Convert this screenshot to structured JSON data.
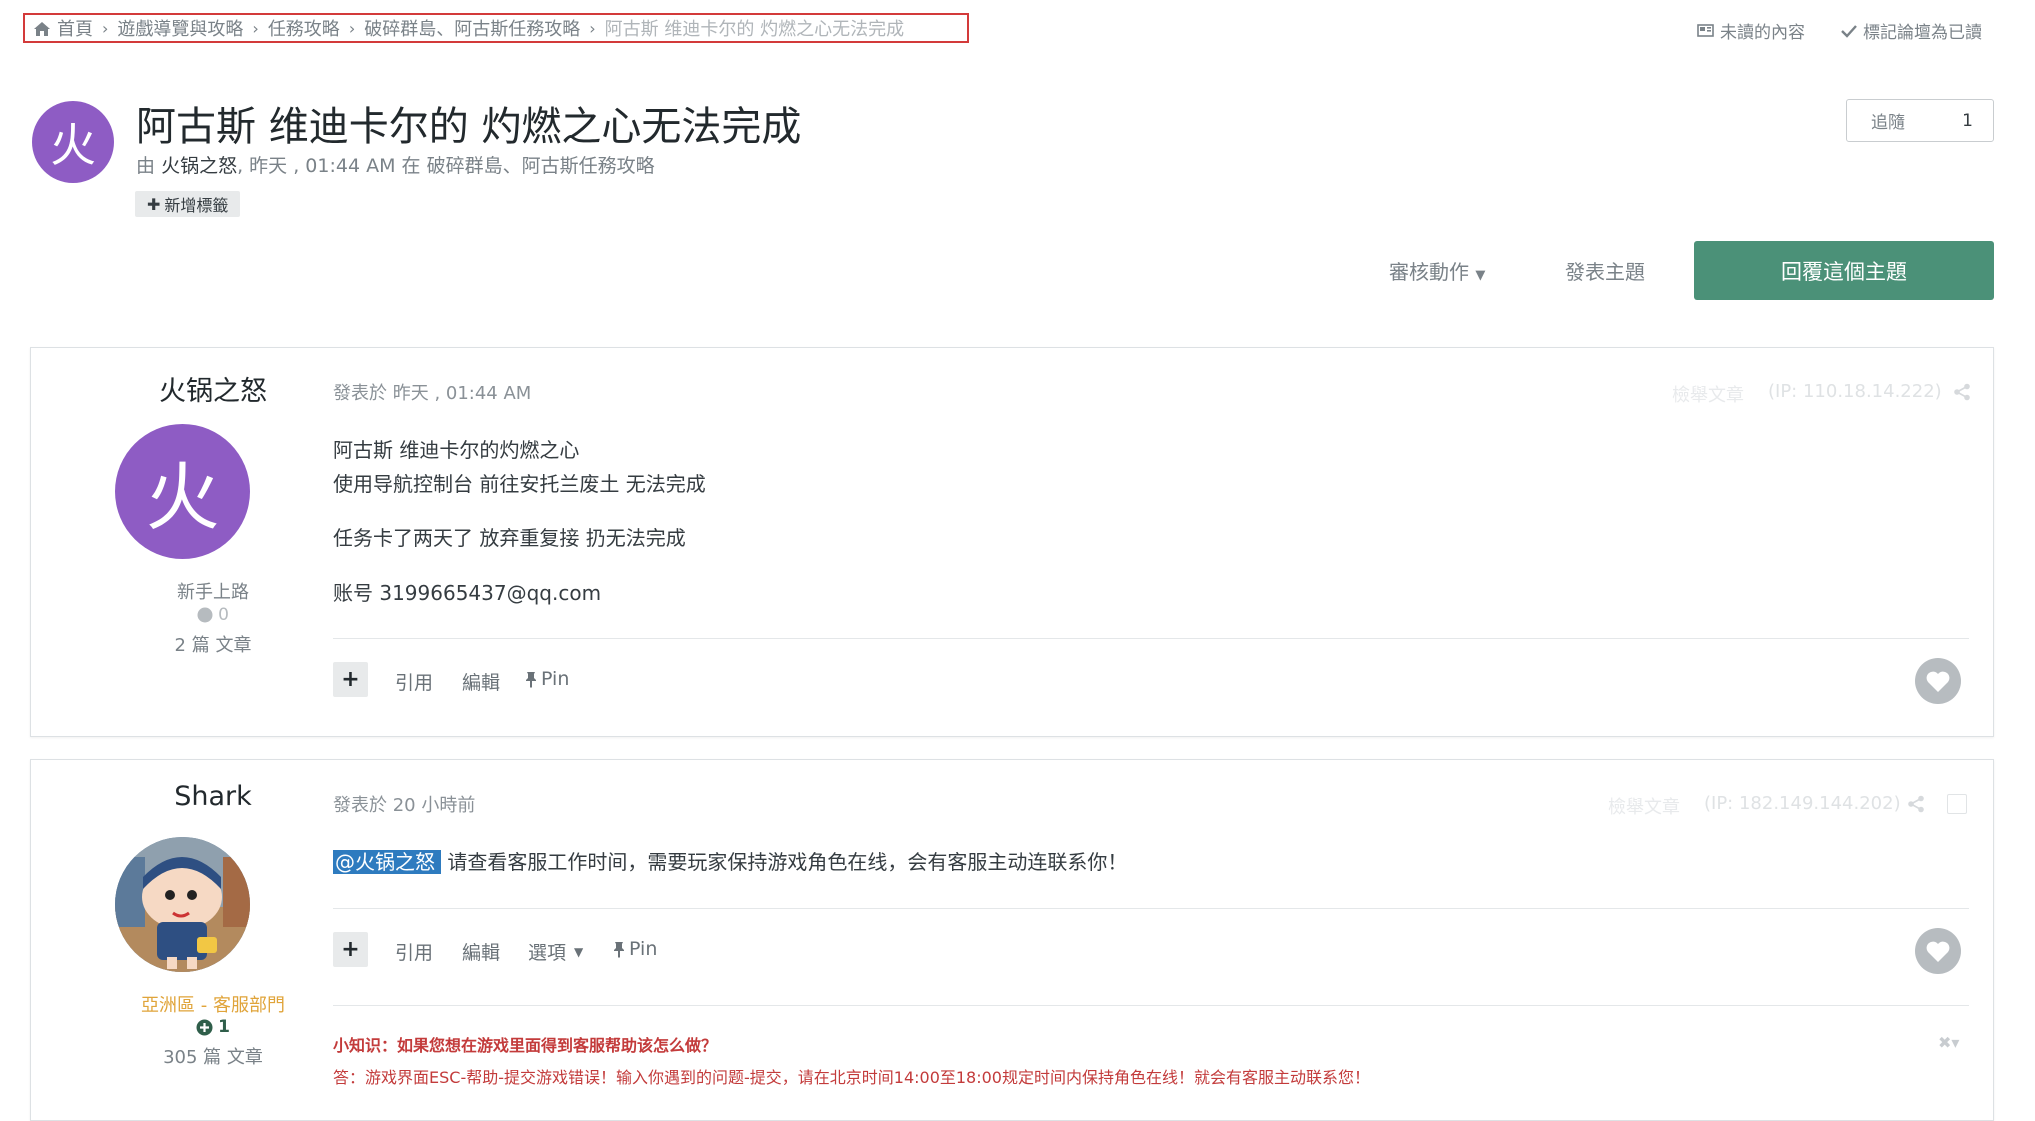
{
  "breadcrumb": {
    "items": [
      "首頁",
      "遊戲導覽與攻略",
      "任務攻略",
      "破碎群島、阿古斯任務攻略",
      "阿古斯 维迪卡尔的 灼燃之心无法完成"
    ],
    "separator": "›"
  },
  "top_links": {
    "unread": "未讀的內容",
    "mark_read": "標記論壇為已讀"
  },
  "topic": {
    "avatar_letter": "火",
    "title": "阿古斯 维迪卡尔的 灼燃之心无法完成",
    "by": "由",
    "author": "火锅之怒",
    "date": ", 昨天 , 01:44 AM",
    "in": "在",
    "forum": "破碎群島、阿古斯任務攻略",
    "add_tag": "新增標籤"
  },
  "follow": {
    "label": "追隨",
    "count": "1"
  },
  "actions": {
    "moderation": "審核動作",
    "new_topic": "發表主題",
    "reply": "回覆這個主題"
  },
  "posts": [
    {
      "author": "火锅之怒",
      "avatar_letter": "火",
      "rank": "新手上路",
      "reputation": "0",
      "post_count": "2 篇 文章",
      "posted": "發表於 昨天 , 01:44 AM",
      "report": "檢舉文章",
      "ip": "(IP: 110.18.14.222)",
      "lines": [
        "阿古斯 维迪卡尔的灼燃之心",
        "使用导航控制台 前往安托兰废土 无法完成",
        "任务卡了两天了 放弃重复接 扔无法完成",
        "账号 3199665437@qq.com"
      ],
      "controls": {
        "quote": "引用",
        "edit": "編輯",
        "pin": "Pin"
      }
    },
    {
      "author": "Shark",
      "rank": "亞洲區 - 客服部門",
      "reputation": "1",
      "post_count": "305 篇 文章",
      "posted": "發表於 20 小時前",
      "report": "檢舉文章",
      "ip": "(IP: 182.149.144.202)",
      "mention": "@火锅之怒",
      "text": "请查看客服工作时间，需要玩家保持游戏角色在线，会有客服主动连联系你！",
      "controls": {
        "quote": "引用",
        "edit": "編輯",
        "options": "選項",
        "pin": "Pin"
      },
      "tip_title": "小知识：如果您想在游戏里面得到客服帮助该怎么做？",
      "tip_answer": "答：游戏界面ESC-帮助-提交游戏错误！输入你遇到的问题-提交，请在北京时间14:00至18:00规定时间内保持角色在线！就会有客服主动联系您！"
    }
  ],
  "colors": {
    "accent": "#4b9178",
    "avatar": "#8e5cc4",
    "staff_rank": "#e0a43a",
    "tip": "#c33b3b",
    "mention": "#2e7bbf"
  }
}
